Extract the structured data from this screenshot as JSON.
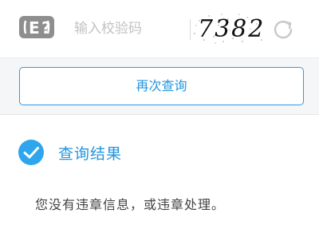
{
  "captcha": {
    "placeholder": "输入校验码",
    "image_text": "7382",
    "icon": "captcha-help-icon",
    "refresh_icon": "refresh-icon"
  },
  "actions": {
    "requery_label": "再次查询"
  },
  "result": {
    "title": "查询结果",
    "message": "您没有违章信息，或违章处理。",
    "icon": "check-circle-icon"
  },
  "colors": {
    "accent": "#2496de",
    "icon_gray": "#8e8e8e"
  }
}
